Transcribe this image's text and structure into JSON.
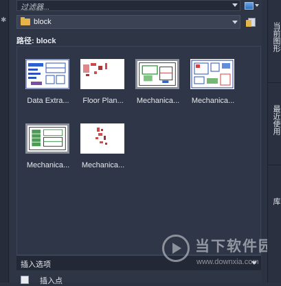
{
  "filter": {
    "placeholder": "过滤器..."
  },
  "folder": {
    "name": "block"
  },
  "path": {
    "label": "路径: block"
  },
  "tiles": [
    {
      "name": "Data Extra...",
      "selected": false
    },
    {
      "name": "Floor Plan...",
      "selected": false
    },
    {
      "name": "Mechanica...",
      "selected": true
    },
    {
      "name": "Mechanica...",
      "selected": false
    },
    {
      "name": "Mechanica...",
      "selected": true
    },
    {
      "name": "Mechanica...",
      "selected": false
    }
  ],
  "insert_options": {
    "header": "插入选项",
    "option1": "插入点"
  },
  "right_tabs": [
    "当前图形",
    "最近使用",
    "库"
  ],
  "watermark": {
    "name": "当下软件园",
    "url": "www.downxia.com"
  },
  "colors": {
    "background": "#2b3242",
    "panel": "#2e3545",
    "folder": "#e6b54a"
  }
}
